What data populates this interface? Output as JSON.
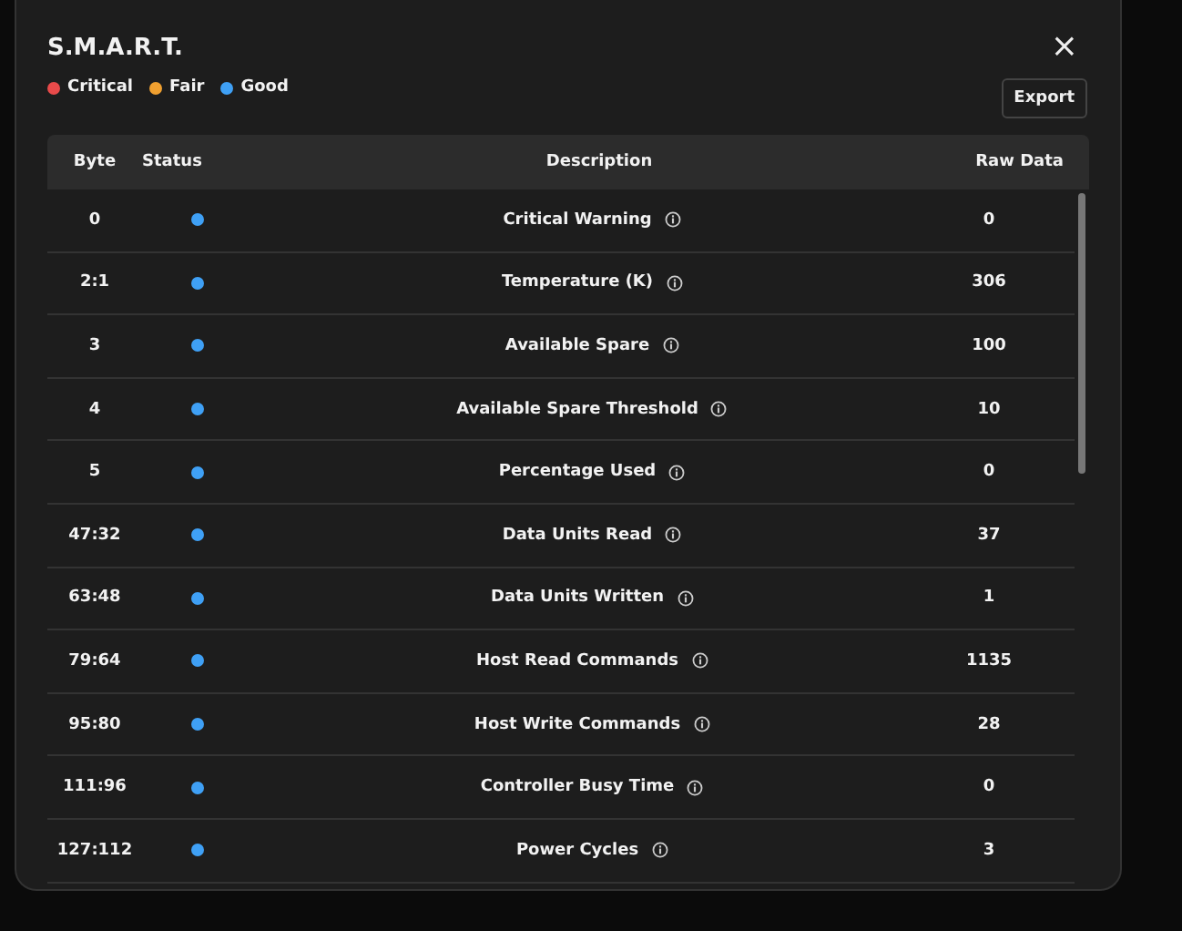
{
  "dialog": {
    "title": "S.M.A.R.T.",
    "close": "×",
    "export_button": "Export"
  },
  "legend": [
    {
      "label": "Critical",
      "color": "#e84a4a"
    },
    {
      "label": "Fair",
      "color": "#f0a030"
    },
    {
      "label": "Good",
      "color": "#3fa0f5"
    }
  ],
  "table": {
    "columns": [
      "Byte",
      "Status",
      "Description",
      "Raw Data"
    ],
    "rows": [
      {
        "byte": "0",
        "color": "#3fa0f5",
        "description": "Critical Warning",
        "raw": "0"
      },
      {
        "byte": "2:1",
        "color": "#3fa0f5",
        "description": "Temperature (K)",
        "raw": "306"
      },
      {
        "byte": "3",
        "color": "#3fa0f5",
        "description": "Available Spare",
        "raw": "100"
      },
      {
        "byte": "4",
        "color": "#3fa0f5",
        "description": "Available Spare Threshold",
        "raw": "10"
      },
      {
        "byte": "5",
        "color": "#3fa0f5",
        "description": "Percentage Used",
        "raw": "0"
      },
      {
        "byte": "47:32",
        "color": "#3fa0f5",
        "description": "Data Units Read",
        "raw": "37"
      },
      {
        "byte": "63:48",
        "color": "#3fa0f5",
        "description": "Data Units Written",
        "raw": "1"
      },
      {
        "byte": "79:64",
        "color": "#3fa0f5",
        "description": "Host Read Commands",
        "raw": "1135"
      },
      {
        "byte": "95:80",
        "color": "#3fa0f5",
        "description": "Host Write Commands",
        "raw": "28"
      },
      {
        "byte": "111:96",
        "color": "#3fa0f5",
        "description": "Controller Busy Time",
        "raw": "0"
      },
      {
        "byte": "127:112",
        "color": "#3fa0f5",
        "description": "Power Cycles",
        "raw": "3"
      }
    ]
  }
}
